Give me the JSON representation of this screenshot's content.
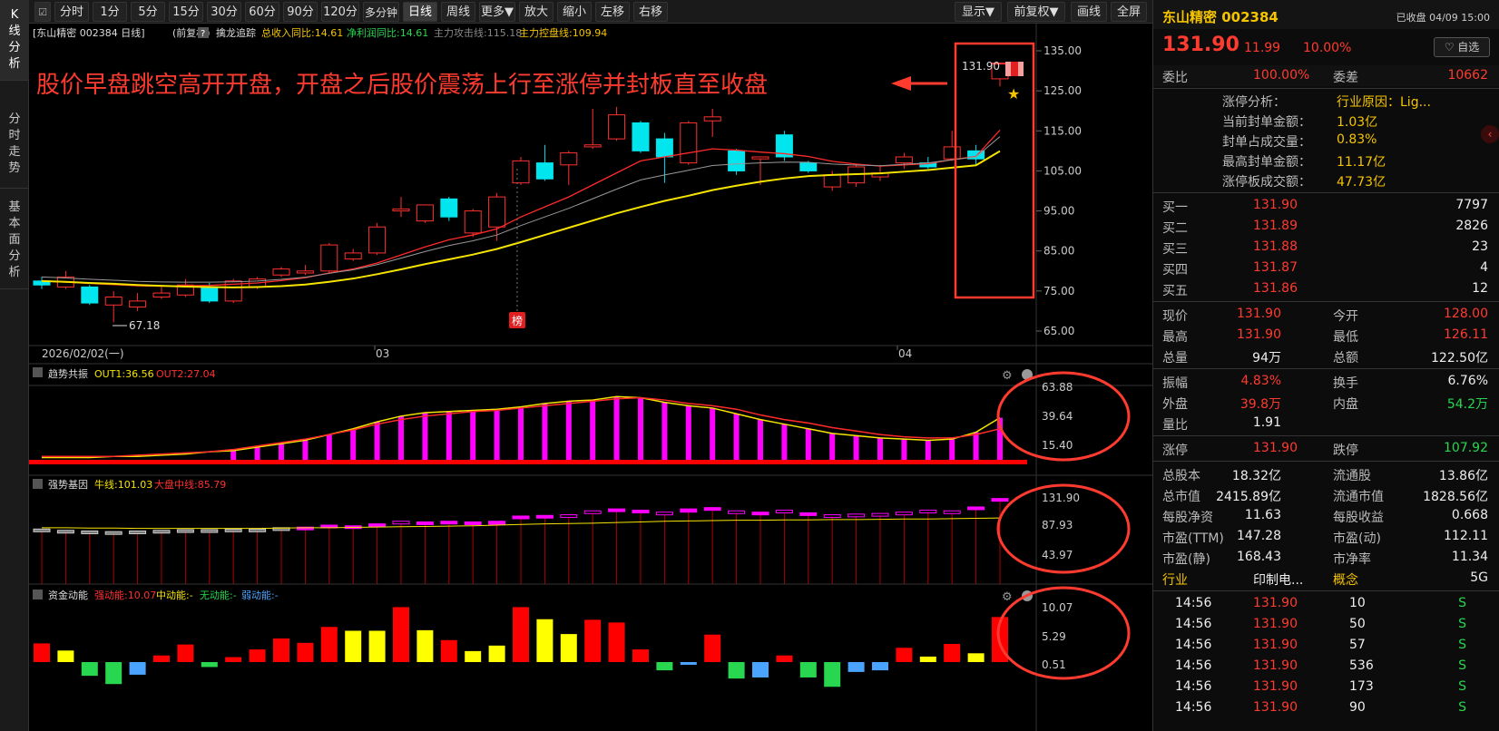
{
  "sidebar": {
    "tabs": [
      {
        "label": "K线分析",
        "chars": [
          "K",
          "线",
          "分",
          "析"
        ]
      },
      {
        "label": "分时走势",
        "chars": [
          "分",
          "时",
          "走",
          "势"
        ]
      },
      {
        "label": "基本面分析",
        "chars": [
          "基",
          "本",
          "面",
          "分",
          "析"
        ]
      }
    ]
  },
  "toolbar": {
    "buttons": [
      "分时",
      "1分",
      "5分",
      "15分",
      "30分",
      "60分",
      "90分",
      "120分",
      "多分钟",
      "日线",
      "周线",
      "更多▼",
      "放大",
      "缩小",
      "左移",
      "右移",
      "显示▼",
      "前复权▼",
      "画线",
      "全屏"
    ],
    "active": "日线"
  },
  "chart_header": {
    "stock": "[东山精密 002384 日线]",
    "adjust": "(前复权)",
    "help": "?",
    "indicator": "擒龙追踪",
    "rev_label": "总收入同比:14.61",
    "profit_label": "净利润同比:14.61",
    "attack_label": "主力攻击线:115.18",
    "control_label": "主力控盘线:109.94"
  },
  "annotation": {
    "text": "股价早盘跳空高开开盘，开盘之后股价震荡上行至涨停并封板直至收盘"
  },
  "price_axis": {
    "ticks": [
      "135.00",
      "125.00",
      "115.00",
      "105.00",
      "95.00",
      "85.00",
      "75.00",
      "65.00"
    ]
  },
  "date_axis": {
    "labels": [
      "2026/02/02(一)",
      "03",
      "04"
    ]
  },
  "markers": {
    "low": "67.18",
    "high_label": "131.90",
    "badge": "榜"
  },
  "panels": {
    "trend": {
      "name": "趋势共振",
      "out1": "OUT1:36.56",
      "out2": "OUT2:27.04",
      "ticks": [
        "63.88",
        "39.64",
        "15.40"
      ]
    },
    "strong": {
      "name": "强势基因",
      "bull": "牛线:101.03",
      "market": "大盘中线:85.79",
      "ticks": [
        "131.90",
        "87.93",
        "43.97"
      ]
    },
    "money": {
      "name": "资金动能",
      "strong": "强动能:10.07",
      "mid": "中动能:-",
      "none": "无动能:-",
      "weak": "弱动能:-",
      "ticks": [
        "10.07",
        "5.29",
        "0.51"
      ]
    }
  },
  "candles": [
    {
      "o": 77.5,
      "c": 76.5,
      "h": 78.5,
      "l": 75.5
    },
    {
      "o": 76.0,
      "c": 78.5,
      "h": 80.0,
      "l": 75.5
    },
    {
      "o": 76.0,
      "c": 72.0,
      "h": 76.5,
      "l": 71.5
    },
    {
      "o": 71.5,
      "c": 73.5,
      "h": 75.0,
      "l": 67.18
    },
    {
      "o": 71.0,
      "c": 72.5,
      "h": 74.5,
      "l": 70.0
    },
    {
      "o": 73.5,
      "c": 74.5,
      "h": 76.0,
      "l": 73.0
    },
    {
      "o": 74.0,
      "c": 76.5,
      "h": 78.0,
      "l": 73.5
    },
    {
      "o": 76.0,
      "c": 72.5,
      "h": 77.0,
      "l": 72.0
    },
    {
      "o": 72.5,
      "c": 77.5,
      "h": 78.0,
      "l": 72.0
    },
    {
      "o": 76.0,
      "c": 78.0,
      "h": 78.5,
      "l": 75.5
    },
    {
      "o": 79.0,
      "c": 80.5,
      "h": 81.0,
      "l": 78.5
    },
    {
      "o": 79.5,
      "c": 80.0,
      "h": 81.5,
      "l": 79.0
    },
    {
      "o": 80.0,
      "c": 86.5,
      "h": 87.0,
      "l": 79.5
    },
    {
      "o": 83.0,
      "c": 84.5,
      "h": 85.5,
      "l": 82.5
    },
    {
      "o": 84.5,
      "c": 91.0,
      "h": 92.0,
      "l": 84.0
    },
    {
      "o": 95.0,
      "c": 95.5,
      "h": 98.5,
      "l": 93.5
    },
    {
      "o": 92.5,
      "c": 96.5,
      "h": 96.5,
      "l": 92.0
    },
    {
      "o": 98.0,
      "c": 93.5,
      "h": 98.5,
      "l": 92.5
    },
    {
      "o": 89.5,
      "c": 95.0,
      "h": 95.5,
      "l": 88.5
    },
    {
      "o": 91.0,
      "c": 98.5,
      "h": 99.5,
      "l": 87.5
    },
    {
      "o": 102.0,
      "c": 107.5,
      "h": 108.5,
      "l": 101.5
    },
    {
      "o": 107.0,
      "c": 103.0,
      "h": 111.5,
      "l": 102.5
    },
    {
      "o": 106.5,
      "c": 109.5,
      "h": 110.0,
      "l": 101.5
    },
    {
      "o": 111.0,
      "c": 111.5,
      "h": 120.5,
      "l": 110.5
    },
    {
      "o": 113.0,
      "c": 119.0,
      "h": 121.0,
      "l": 112.5
    },
    {
      "o": 117.0,
      "c": 110.0,
      "h": 117.5,
      "l": 109.5
    },
    {
      "o": 113.0,
      "c": 108.5,
      "h": 114.5,
      "l": 102.0
    },
    {
      "o": 107.0,
      "c": 117.0,
      "h": 117.5,
      "l": 106.5
    },
    {
      "o": 117.5,
      "c": 118.5,
      "h": 120.5,
      "l": 113.5
    },
    {
      "o": 110.0,
      "c": 105.0,
      "h": 110.5,
      "l": 104.0
    },
    {
      "o": 108.0,
      "c": 108.5,
      "h": 108.5,
      "l": 101.5
    },
    {
      "o": 114.0,
      "c": 108.5,
      "h": 115.0,
      "l": 107.5
    },
    {
      "o": 107.0,
      "c": 105.0,
      "h": 107.5,
      "l": 104.5
    },
    {
      "o": 101.0,
      "c": 104.0,
      "h": 105.0,
      "l": 100.0
    },
    {
      "o": 102.0,
      "c": 106.0,
      "h": 106.5,
      "l": 101.0
    },
    {
      "o": 103.5,
      "c": 104.5,
      "h": 106.5,
      "l": 102.5
    },
    {
      "o": 107.0,
      "c": 108.5,
      "h": 109.5,
      "l": 105.5
    },
    {
      "o": 107.0,
      "c": 106.0,
      "h": 108.5,
      "l": 105.5
    },
    {
      "o": 108.0,
      "c": 111.0,
      "h": 115.0,
      "l": 107.5
    },
    {
      "o": 110.0,
      "c": 108.0,
      "h": 111.5,
      "l": 106.5
    },
    {
      "o": 128.0,
      "c": 131.9,
      "h": 131.9,
      "l": 126.11
    }
  ],
  "ma_attack": [
    77.5,
    77.2,
    76.9,
    76.6,
    76.3,
    76.2,
    76.3,
    76.4,
    76.7,
    77.0,
    77.6,
    78.3,
    79.5,
    80.5,
    82.0,
    84.0,
    86.0,
    87.8,
    89.0,
    90.5,
    93.5,
    96.0,
    98.5,
    101.5,
    104.5,
    107.5,
    108.5,
    109.5,
    110.5,
    110.2,
    109.7,
    109.3,
    108.6,
    107.4,
    106.7,
    106.2,
    106.5,
    106.8,
    107.8,
    108.6,
    115.18
  ],
  "ma_control": [
    77.5,
    77.3,
    77.0,
    76.8,
    76.5,
    76.3,
    76.1,
    76.0,
    75.9,
    76.0,
    76.2,
    76.6,
    77.3,
    78.1,
    79.2,
    80.4,
    81.7,
    82.9,
    84.1,
    85.5,
    87.2,
    89.0,
    90.8,
    92.6,
    94.4,
    96.0,
    97.5,
    98.8,
    100.2,
    101.3,
    102.3,
    103.1,
    103.7,
    104.0,
    104.2,
    104.4,
    104.8,
    105.2,
    105.8,
    106.4,
    109.94
  ],
  "trend_vals": [
    2,
    2,
    2,
    3,
    3,
    4,
    5,
    7,
    8,
    11,
    14,
    17,
    22,
    27,
    33,
    38,
    41,
    42,
    43,
    44,
    46,
    49,
    51,
    52,
    55,
    54,
    50,
    47,
    45,
    40,
    35,
    31,
    27,
    23,
    21,
    19,
    18,
    17,
    18,
    24,
    36.56
  ],
  "trend_out2": [
    3,
    3,
    3,
    3,
    4,
    5,
    6,
    7,
    9,
    12,
    15,
    18,
    22,
    26,
    31,
    35,
    38,
    40,
    42,
    43,
    45,
    47,
    49,
    51,
    53,
    54,
    52,
    49,
    47,
    44,
    39,
    35,
    32,
    28,
    25,
    22,
    20,
    19,
    19,
    22,
    27.04
  ],
  "strong_vals": [
    {
      "t": 84,
      "b": 82,
      "c": "#cccccc",
      "f": "#777"
    },
    {
      "t": 82,
      "b": 80,
      "c": "#cccccc",
      "f": "#777"
    },
    {
      "t": 81,
      "b": 78,
      "c": "#cccccc",
      "f": "#777"
    },
    {
      "t": 80,
      "b": 77,
      "c": "#cccccc",
      "f": "#777"
    },
    {
      "t": 81,
      "b": 79,
      "c": "#cccccc",
      "f": "#777"
    },
    {
      "t": 82,
      "b": 80,
      "c": "#cccccc",
      "f": "#777"
    },
    {
      "t": 83,
      "b": 81,
      "c": "#cccccc",
      "f": "#777"
    },
    {
      "t": 83,
      "b": 81,
      "c": "#cccccc",
      "f": "#777"
    },
    {
      "t": 84,
      "b": 82,
      "c": "#cccccc",
      "f": "#777"
    },
    {
      "t": 84,
      "b": 83,
      "c": "#cccccc",
      "f": "#777"
    },
    {
      "t": 86,
      "b": 85,
      "c": "#cccccc",
      "f": "#777"
    },
    {
      "t": 87,
      "b": 86,
      "c": "#ff00ff",
      "f": "#ff00ff"
    },
    {
      "t": 90,
      "b": 86,
      "c": "#ff00ff",
      "f": "#ff00ff"
    },
    {
      "t": 89,
      "b": 86,
      "c": "#ff00ff",
      "f": "#ff00ff"
    },
    {
      "t": 92,
      "b": 88,
      "c": "#ff00ff",
      "f": "#ff00ff"
    },
    {
      "t": 96,
      "b": 94,
      "c": "#ff00ff",
      "f": "none"
    },
    {
      "t": 95,
      "b": 93,
      "c": "#ff00ff",
      "f": "#ff00ff"
    },
    {
      "t": 96,
      "b": 93,
      "c": "#ff00ff",
      "f": "#ff00ff"
    },
    {
      "t": 95,
      "b": 92,
      "c": "#ff00ff",
      "f": "#ff00ff"
    },
    {
      "t": 96,
      "b": 91,
      "c": "#ff00ff",
      "f": "#ff00ff"
    },
    {
      "t": 104,
      "b": 102,
      "c": "#ff00ff",
      "f": "#ff00ff"
    },
    {
      "t": 105,
      "b": 103,
      "c": "#ff00ff",
      "f": "#ff00ff"
    },
    {
      "t": 106,
      "b": 104,
      "c": "#ff00ff",
      "f": "none"
    },
    {
      "t": 112,
      "b": 109,
      "c": "#ff00ff",
      "f": "none"
    },
    {
      "t": 115,
      "b": 111,
      "c": "#ff00ff",
      "f": "#ff00ff"
    },
    {
      "t": 113,
      "b": 109,
      "c": "#ff00ff",
      "f": "#ff00ff"
    },
    {
      "t": 110,
      "b": 106,
      "c": "#ff00ff",
      "f": "none"
    },
    {
      "t": 115,
      "b": 110,
      "c": "#ff00ff",
      "f": "#ff00ff"
    },
    {
      "t": 117,
      "b": 114,
      "c": "#ff00ff",
      "f": "#ff00ff"
    },
    {
      "t": 112,
      "b": 108,
      "c": "#ff00ff",
      "f": "none"
    },
    {
      "t": 110,
      "b": 107,
      "c": "#ff00ff",
      "f": "#ff00ff"
    },
    {
      "t": 113,
      "b": 109,
      "c": "#ff00ff",
      "f": "none"
    },
    {
      "t": 109,
      "b": 105,
      "c": "#ff00ff",
      "f": "#ff00ff"
    },
    {
      "t": 106,
      "b": 103,
      "c": "#ff00ff",
      "f": "none"
    },
    {
      "t": 107,
      "b": 104,
      "c": "#ff00ff",
      "f": "none"
    },
    {
      "t": 108,
      "b": 104,
      "c": "#ff00ff",
      "f": "none"
    },
    {
      "t": 110,
      "b": 107,
      "c": "#ff00ff",
      "f": "none"
    },
    {
      "t": 113,
      "b": 109,
      "c": "#ff00ff",
      "f": "none"
    },
    {
      "t": 112,
      "b": 108,
      "c": "#ff00ff",
      "f": "none"
    },
    {
      "t": 118,
      "b": 116,
      "c": "#ff00ff",
      "f": "#ff00ff"
    },
    {
      "t": 131,
      "b": 127,
      "c": "#ff00ff",
      "f": "#ff00ff"
    }
  ],
  "strong_bull": [
    86,
    86,
    85.5,
    85.5,
    85,
    85,
    85,
    85,
    85,
    85,
    85.5,
    86,
    86,
    86.5,
    87,
    87.5,
    88,
    88.5,
    89,
    90,
    91,
    92,
    92.5,
    93,
    94,
    95,
    96,
    96.5,
    97,
    97.5,
    97.5,
    98,
    98,
    98.5,
    98.5,
    99,
    99.5,
    99.5,
    100,
    100.5,
    101
  ],
  "money_vals": [
    {
      "v": 3.4,
      "c": "#ff0000"
    },
    {
      "v": 2.1,
      "c": "#ffff00"
    },
    {
      "v": -2.5,
      "c": "#29d64f"
    },
    {
      "v": -4.0,
      "c": "#29d64f"
    },
    {
      "v": -2.3,
      "c": "#4aa4ff"
    },
    {
      "v": 1.2,
      "c": "#ff0000"
    },
    {
      "v": 3.2,
      "c": "#ff0000"
    },
    {
      "v": -0.9,
      "c": "#29d64f"
    },
    {
      "v": 0.9,
      "c": "#ff0000"
    },
    {
      "v": 2.3,
      "c": "#ff0000"
    },
    {
      "v": 4.3,
      "c": "#ff0000"
    },
    {
      "v": 3.5,
      "c": "#ff0000"
    },
    {
      "v": 6.4,
      "c": "#ff0000"
    },
    {
      "v": 5.7,
      "c": "#ffff00"
    },
    {
      "v": 5.7,
      "c": "#ffff00"
    },
    {
      "v": 10.0,
      "c": "#ff0000"
    },
    {
      "v": 5.8,
      "c": "#ffff00"
    },
    {
      "v": 4.0,
      "c": "#ff0000"
    },
    {
      "v": 2.0,
      "c": "#ffff00"
    },
    {
      "v": 3.0,
      "c": "#ffff00"
    },
    {
      "v": 10.0,
      "c": "#ff0000"
    },
    {
      "v": 7.8,
      "c": "#ffff00"
    },
    {
      "v": 5.1,
      "c": "#ffff00"
    },
    {
      "v": 7.7,
      "c": "#ff0000"
    },
    {
      "v": 7.2,
      "c": "#ff0000"
    },
    {
      "v": 2.3,
      "c": "#ff0000"
    },
    {
      "v": -1.5,
      "c": "#29d64f"
    },
    {
      "v": -0.5,
      "c": "#4aa4ff"
    },
    {
      "v": 5.0,
      "c": "#ff0000"
    },
    {
      "v": -3.0,
      "c": "#29d64f"
    },
    {
      "v": -2.8,
      "c": "#4aa4ff"
    },
    {
      "v": 1.2,
      "c": "#ff0000"
    },
    {
      "v": -2.8,
      "c": "#29d64f"
    },
    {
      "v": -4.5,
      "c": "#29d64f"
    },
    {
      "v": -1.8,
      "c": "#4aa4ff"
    },
    {
      "v": -1.5,
      "c": "#4aa4ff"
    },
    {
      "v": 2.6,
      "c": "#ff0000"
    },
    {
      "v": 1.0,
      "c": "#ffff00"
    },
    {
      "v": 3.3,
      "c": "#ff0000"
    },
    {
      "v": 1.6,
      "c": "#ffff00"
    },
    {
      "v": 8.2,
      "c": "#ff0000"
    },
    {
      "v": 10.07,
      "c": "#ff0000"
    }
  ],
  "quote": {
    "name": "东山精密 002384",
    "closed": "已收盘 04/09 15:00",
    "price": "131.90",
    "change": "11.99",
    "pct": "10.00%",
    "fav": "♡ 自选",
    "weibi_label": "委比",
    "weibi": "100.00%",
    "weicha_label": "委差",
    "weicha": "10662",
    "limit_analysis": [
      {
        "k": "涨停分析：",
        "v": "行业原因：Lig..."
      },
      {
        "k": "当前封单金额：",
        "v": "1.03亿"
      },
      {
        "k": "封单占成交量：",
        "v": "0.83%"
      },
      {
        "k": "最高封单金额：",
        "v": "11.17亿"
      },
      {
        "k": "涨停板成交额：",
        "v": "47.73亿"
      }
    ],
    "bids": [
      {
        "k": "买一",
        "p": "131.90",
        "q": "7797"
      },
      {
        "k": "买二",
        "p": "131.89",
        "q": "2826"
      },
      {
        "k": "买三",
        "p": "131.88",
        "q": "23"
      },
      {
        "k": "买四",
        "p": "131.87",
        "q": "4"
      },
      {
        "k": "买五",
        "p": "131.86",
        "q": "12"
      }
    ],
    "stats1": [
      {
        "k1": "现价",
        "v1": "131.90",
        "c1": "red",
        "k2": "今开",
        "v2": "128.00",
        "c2": "red"
      },
      {
        "k1": "最高",
        "v1": "131.90",
        "c1": "red",
        "k2": "最低",
        "v2": "126.11",
        "c2": "red"
      },
      {
        "k1": "总量",
        "v1": "94万",
        "c1": "white",
        "k2": "总额",
        "v2": "122.50亿",
        "c2": "white"
      }
    ],
    "stats2": [
      {
        "k1": "振幅",
        "v1": "4.83%",
        "c1": "red",
        "k2": "换手",
        "v2": "6.76%",
        "c2": "white"
      },
      {
        "k1": "外盘",
        "v1": "39.8万",
        "c1": "red",
        "k2": "内盘",
        "v2": "54.2万",
        "c2": "green"
      },
      {
        "k1": "量比",
        "v1": "1.91",
        "c1": "white",
        "k2": "",
        "v2": "",
        "c2": "white"
      }
    ],
    "limits": {
      "k1": "涨停",
      "v1": "131.90",
      "k2": "跌停",
      "v2": "107.92"
    },
    "stats3": [
      {
        "k1": "总股本",
        "v1": "18.32亿",
        "k2": "流通股",
        "v2": "13.86亿"
      },
      {
        "k1": "总市值",
        "v1": "2415.89亿",
        "k2": "流通市值",
        "v2": "1828.56亿"
      },
      {
        "k1": "每股净资",
        "v1": "11.63",
        "k2": "每股收益",
        "v2": "0.668"
      },
      {
        "k1": "市盈(TTM)",
        "v1": "147.28",
        "k2": "市盈(动)",
        "v2": "112.11"
      },
      {
        "k1": "市盈(静)",
        "v1": "168.43",
        "k2": "市净率",
        "v2": "11.34"
      }
    ],
    "industry": {
      "k1": "行业",
      "v1": "印制电...",
      "k2": "概念",
      "v2": "5G"
    },
    "ticks": [
      {
        "t": "14:56",
        "p": "131.90",
        "q": "10",
        "s": "S"
      },
      {
        "t": "14:56",
        "p": "131.90",
        "q": "50",
        "s": "S"
      },
      {
        "t": "14:56",
        "p": "131.90",
        "q": "57",
        "s": "S"
      },
      {
        "t": "14:56",
        "p": "131.90",
        "q": "536",
        "s": "S"
      },
      {
        "t": "14:56",
        "p": "131.90",
        "q": "173",
        "s": "S"
      },
      {
        "t": "14:56",
        "p": "131.90",
        "q": "90",
        "s": "S"
      }
    ]
  }
}
